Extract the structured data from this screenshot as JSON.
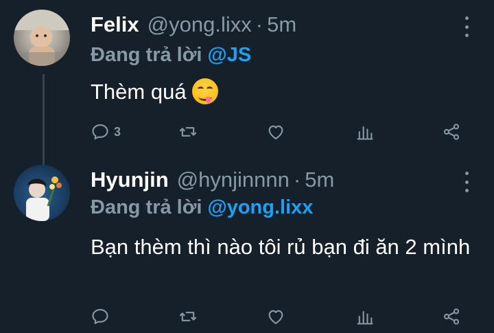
{
  "tweets": [
    {
      "name": "Felix",
      "handle": "@yong.lixx",
      "dot": "·",
      "time": "5m",
      "reply_prefix": "Đang trả lời",
      "reply_to": "@JS",
      "text": "Thèm quá",
      "emoji": "drooling-face-emoji",
      "reply_count": "3",
      "avatar": "avatar-photo-baby"
    },
    {
      "name": "Hyunjin",
      "handle": "@hynjinnnn",
      "dot": "·",
      "time": "5m",
      "reply_prefix": "Đang trả lời",
      "reply_to": "@yong.lixx",
      "text": "Bạn thèm thì nào tôi rủ bạn đi ăn 2 mình",
      "avatar": "avatar-photo-flowers"
    }
  ],
  "icons": {
    "reply": "comment-icon",
    "retweet": "retweet-icon",
    "like": "heart-icon",
    "stats": "analytics-icon",
    "share": "share-icon",
    "more": "more-vertical-icon"
  },
  "colors": {
    "background": "#15202b",
    "muted": "#8899a6",
    "link": "#1da1f2",
    "thread_line": "#38444d"
  }
}
